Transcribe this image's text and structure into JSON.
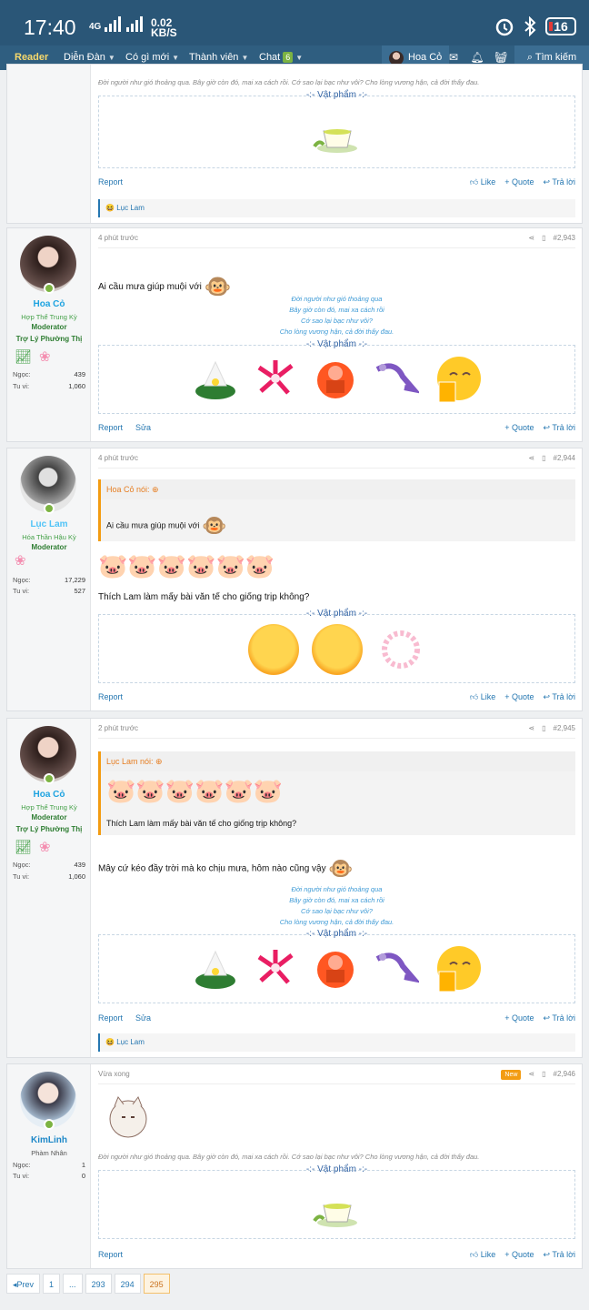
{
  "status": {
    "time": "17:40",
    "net": "4G",
    "speed_top": "0.02",
    "speed_bot": "KB/S",
    "battery": "16"
  },
  "nav": {
    "reader": "Reader",
    "forum": "Diễn Đàn",
    "new": "Có gì mới",
    "members": "Thành viên",
    "chat": "Chat",
    "chat_badge": "6",
    "user": "Hoa Cỏ",
    "search": "Tìm kiếm"
  },
  "sig": [
    "Đời người như gió thoảng qua",
    "Bây giờ còn đó, mai xa cách rồi",
    "Cớ sao lại bạc như vôi?",
    "Cho lòng vương hận, cả đời thấy đau."
  ],
  "sig_inline": "Đời người như gió thoảng qua. Bây giờ còn đó, mai xa cách rồi. Cớ sao lại bạc như vôi? Cho lòng vương hận, cả đời thấy đau.",
  "item_title": "-:- Vật phẩm -:-",
  "actions": {
    "report": "Report",
    "edit": "Sửa",
    "like": "Like",
    "quote": "+ Quote",
    "reply": "Trả lời"
  },
  "stats_labels": {
    "ngoc": "Ngọc:",
    "tuvi": "Tu vi:"
  },
  "react_user": "Lục Lam",
  "users": {
    "hoaco": {
      "name": "Hoa Cỏ",
      "title": "Hợp Thể Trung Kỳ",
      "role": "Moderator",
      "role2": "Trợ Lý Phường Thị",
      "ngoc": "439",
      "tuvi": "1,060"
    },
    "luclam": {
      "name": "Lục Lam",
      "title": "Hóa Thần Hậu Kỳ",
      "role": "Moderator",
      "ngoc": "17,229",
      "tuvi": "527"
    },
    "kimlinh": {
      "name": "KimLinh",
      "title": "Phàm Nhân",
      "ngoc": "1",
      "tuvi": "0"
    }
  },
  "posts": [
    {
      "time": "4 phút trước",
      "num": "#2,943",
      "text": "Ai cầu mưa giúp muội với"
    },
    {
      "time": "4 phút trước",
      "num": "#2,944",
      "quote_author": "Hoa Cỏ nói:",
      "quote_text": "Ai cầu mưa giúp muội với",
      "text": "Thích Lam làm mấy bài văn tế cho giống trịp không?"
    },
    {
      "time": "2 phút trước",
      "num": "#2,945",
      "quote_author": "Lục Lam nói:",
      "quote_text": "Thích Lam làm mấy bài văn tế cho giống trịp không?",
      "text": "Mây cứ kéo đầy trời mà ko chịu mưa, hôm nào cũng vậy"
    },
    {
      "time": "Vừa xong",
      "num": "#2,946",
      "new": "New"
    }
  ],
  "pager": {
    "prev": "◂Prev",
    "p1": "1",
    "dots": "...",
    "p293": "293",
    "p294": "294",
    "p295": "295"
  }
}
